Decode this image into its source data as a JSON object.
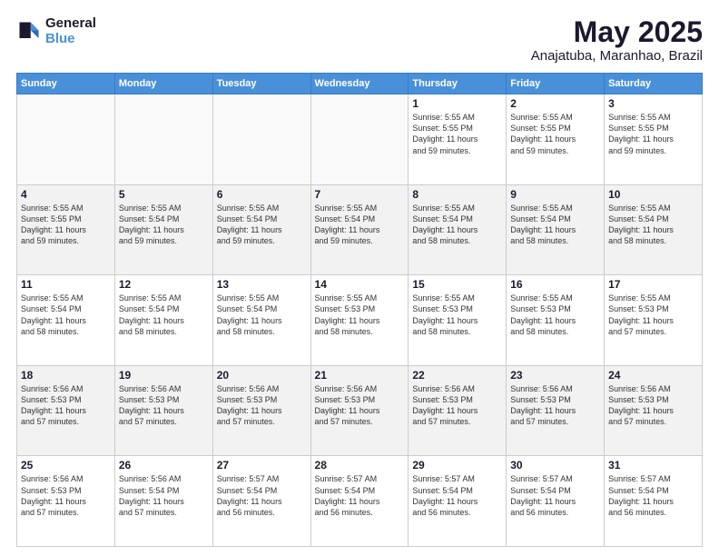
{
  "header": {
    "logo_line1": "General",
    "logo_line2": "Blue",
    "month": "May 2025",
    "location": "Anajatuba, Maranhao, Brazil"
  },
  "weekdays": [
    "Sunday",
    "Monday",
    "Tuesday",
    "Wednesday",
    "Thursday",
    "Friday",
    "Saturday"
  ],
  "weeks": [
    [
      {
        "day": "",
        "info": ""
      },
      {
        "day": "",
        "info": ""
      },
      {
        "day": "",
        "info": ""
      },
      {
        "day": "",
        "info": ""
      },
      {
        "day": "1",
        "info": "Sunrise: 5:55 AM\nSunset: 5:55 PM\nDaylight: 11 hours\nand 59 minutes."
      },
      {
        "day": "2",
        "info": "Sunrise: 5:55 AM\nSunset: 5:55 PM\nDaylight: 11 hours\nand 59 minutes."
      },
      {
        "day": "3",
        "info": "Sunrise: 5:55 AM\nSunset: 5:55 PM\nDaylight: 11 hours\nand 59 minutes."
      }
    ],
    [
      {
        "day": "4",
        "info": "Sunrise: 5:55 AM\nSunset: 5:55 PM\nDaylight: 11 hours\nand 59 minutes."
      },
      {
        "day": "5",
        "info": "Sunrise: 5:55 AM\nSunset: 5:54 PM\nDaylight: 11 hours\nand 59 minutes."
      },
      {
        "day": "6",
        "info": "Sunrise: 5:55 AM\nSunset: 5:54 PM\nDaylight: 11 hours\nand 59 minutes."
      },
      {
        "day": "7",
        "info": "Sunrise: 5:55 AM\nSunset: 5:54 PM\nDaylight: 11 hours\nand 59 minutes."
      },
      {
        "day": "8",
        "info": "Sunrise: 5:55 AM\nSunset: 5:54 PM\nDaylight: 11 hours\nand 58 minutes."
      },
      {
        "day": "9",
        "info": "Sunrise: 5:55 AM\nSunset: 5:54 PM\nDaylight: 11 hours\nand 58 minutes."
      },
      {
        "day": "10",
        "info": "Sunrise: 5:55 AM\nSunset: 5:54 PM\nDaylight: 11 hours\nand 58 minutes."
      }
    ],
    [
      {
        "day": "11",
        "info": "Sunrise: 5:55 AM\nSunset: 5:54 PM\nDaylight: 11 hours\nand 58 minutes."
      },
      {
        "day": "12",
        "info": "Sunrise: 5:55 AM\nSunset: 5:54 PM\nDaylight: 11 hours\nand 58 minutes."
      },
      {
        "day": "13",
        "info": "Sunrise: 5:55 AM\nSunset: 5:54 PM\nDaylight: 11 hours\nand 58 minutes."
      },
      {
        "day": "14",
        "info": "Sunrise: 5:55 AM\nSunset: 5:53 PM\nDaylight: 11 hours\nand 58 minutes."
      },
      {
        "day": "15",
        "info": "Sunrise: 5:55 AM\nSunset: 5:53 PM\nDaylight: 11 hours\nand 58 minutes."
      },
      {
        "day": "16",
        "info": "Sunrise: 5:55 AM\nSunset: 5:53 PM\nDaylight: 11 hours\nand 58 minutes."
      },
      {
        "day": "17",
        "info": "Sunrise: 5:55 AM\nSunset: 5:53 PM\nDaylight: 11 hours\nand 57 minutes."
      }
    ],
    [
      {
        "day": "18",
        "info": "Sunrise: 5:56 AM\nSunset: 5:53 PM\nDaylight: 11 hours\nand 57 minutes."
      },
      {
        "day": "19",
        "info": "Sunrise: 5:56 AM\nSunset: 5:53 PM\nDaylight: 11 hours\nand 57 minutes."
      },
      {
        "day": "20",
        "info": "Sunrise: 5:56 AM\nSunset: 5:53 PM\nDaylight: 11 hours\nand 57 minutes."
      },
      {
        "day": "21",
        "info": "Sunrise: 5:56 AM\nSunset: 5:53 PM\nDaylight: 11 hours\nand 57 minutes."
      },
      {
        "day": "22",
        "info": "Sunrise: 5:56 AM\nSunset: 5:53 PM\nDaylight: 11 hours\nand 57 minutes."
      },
      {
        "day": "23",
        "info": "Sunrise: 5:56 AM\nSunset: 5:53 PM\nDaylight: 11 hours\nand 57 minutes."
      },
      {
        "day": "24",
        "info": "Sunrise: 5:56 AM\nSunset: 5:53 PM\nDaylight: 11 hours\nand 57 minutes."
      }
    ],
    [
      {
        "day": "25",
        "info": "Sunrise: 5:56 AM\nSunset: 5:53 PM\nDaylight: 11 hours\nand 57 minutes."
      },
      {
        "day": "26",
        "info": "Sunrise: 5:56 AM\nSunset: 5:54 PM\nDaylight: 11 hours\nand 57 minutes."
      },
      {
        "day": "27",
        "info": "Sunrise: 5:57 AM\nSunset: 5:54 PM\nDaylight: 11 hours\nand 56 minutes."
      },
      {
        "day": "28",
        "info": "Sunrise: 5:57 AM\nSunset: 5:54 PM\nDaylight: 11 hours\nand 56 minutes."
      },
      {
        "day": "29",
        "info": "Sunrise: 5:57 AM\nSunset: 5:54 PM\nDaylight: 11 hours\nand 56 minutes."
      },
      {
        "day": "30",
        "info": "Sunrise: 5:57 AM\nSunset: 5:54 PM\nDaylight: 11 hours\nand 56 minutes."
      },
      {
        "day": "31",
        "info": "Sunrise: 5:57 AM\nSunset: 5:54 PM\nDaylight: 11 hours\nand 56 minutes."
      }
    ]
  ]
}
